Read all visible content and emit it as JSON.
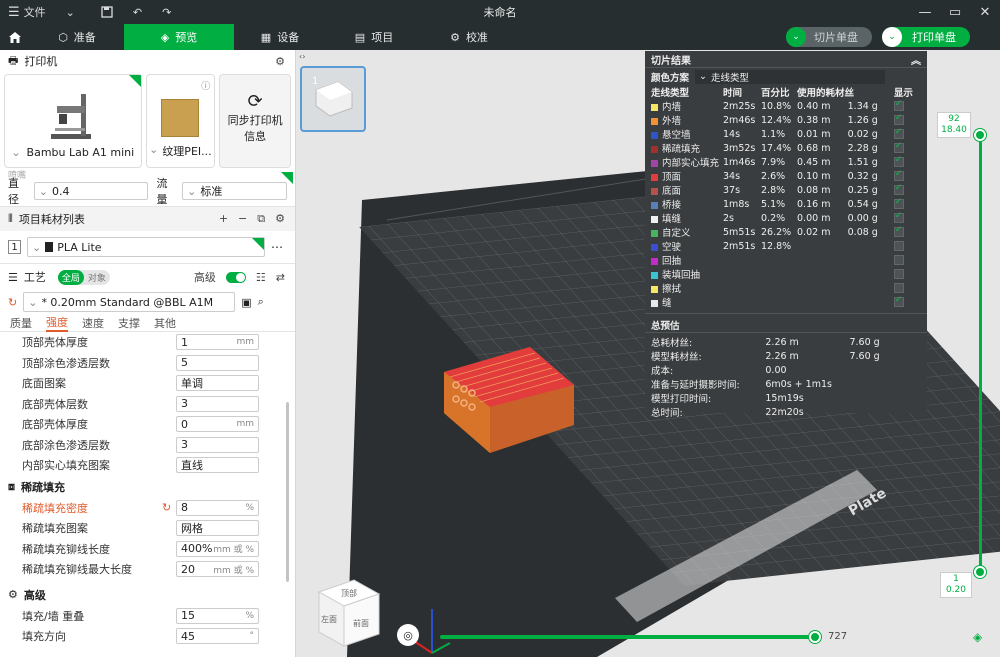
{
  "titlebar": {
    "file_menu": "文件",
    "title": "未命名"
  },
  "tabs": [
    {
      "label": "准备"
    },
    {
      "label": "预览"
    },
    {
      "label": "设备"
    },
    {
      "label": "项目"
    },
    {
      "label": "校准"
    }
  ],
  "actions": {
    "slice_plate": "切片单盘",
    "print_plate": "打印单盘"
  },
  "printer": {
    "section_title": "打印机",
    "model": "Bambu Lab A1 mini",
    "plate": "纹理PEI...",
    "sync_label_1": "同步打印机",
    "sync_label_2": "信息",
    "nozzle_group": "喷嘴",
    "nozzle_label": "直径",
    "nozzle_value": "0.4",
    "flow_label": "流量",
    "flow_value": "标准"
  },
  "filament": {
    "section_title": "项目耗材列表",
    "slot": "1",
    "name": "PLA Lite"
  },
  "process": {
    "section_title": "工艺",
    "global": "全局",
    "object": "对象",
    "advanced": "高级",
    "preset": "* 0.20mm Standard @BBL A1M",
    "subtabs": [
      "质量",
      "强度",
      "速度",
      "支撑",
      "其他"
    ]
  },
  "params_top": [
    {
      "label": "顶部壳体厚度",
      "value": "1",
      "unit": "mm"
    },
    {
      "label": "顶部涂色渗透层数",
      "value": "5",
      "unit": ""
    },
    {
      "label": "底面图案",
      "value": "单调",
      "unit": ""
    },
    {
      "label": "底部壳体层数",
      "value": "3",
      "unit": ""
    },
    {
      "label": "底部壳体厚度",
      "value": "0",
      "unit": "mm"
    },
    {
      "label": "底部涂色渗透层数",
      "value": "3",
      "unit": ""
    },
    {
      "label": "内部实心填充图案",
      "value": "直线",
      "unit": ""
    }
  ],
  "sparse": {
    "title": "稀疏填充",
    "rows": [
      {
        "label": "稀疏填充密度",
        "value": "8",
        "unit": "%"
      },
      {
        "label": "稀疏填充图案",
        "value": "网格",
        "unit": ""
      },
      {
        "label": "稀疏填充铆线长度",
        "value": "400%",
        "unit": "mm 或 %"
      },
      {
        "label": "稀疏填充铆线最大长度",
        "value": "20",
        "unit": "mm 或 %"
      }
    ]
  },
  "advanced": {
    "title": "高级",
    "rows": [
      {
        "label": "填充/墙 重叠",
        "value": "15",
        "unit": "%"
      },
      {
        "label": "填充方向",
        "value": "45",
        "unit": "°"
      }
    ]
  },
  "results": {
    "title": "切片结果",
    "scheme_label": "颜色方案",
    "scheme_value": "走线类型",
    "headers": [
      "走线类型",
      "时间",
      "百分比",
      "使用的耗材丝",
      "",
      "显示"
    ],
    "rows": [
      {
        "name": "内墙",
        "color": "#f5e663",
        "time": "2m25s",
        "pct": "10.8%",
        "len": "0.40 m",
        "wt": "1.34 g",
        "show": true
      },
      {
        "name": "外墙",
        "color": "#f29235",
        "time": "2m46s",
        "pct": "12.4%",
        "len": "0.38 m",
        "wt": "1.26 g",
        "show": true
      },
      {
        "name": "悬空墙",
        "color": "#2d54c9",
        "time": "14s",
        "pct": "1.1%",
        "len": "0.01 m",
        "wt": "0.02 g",
        "show": true
      },
      {
        "name": "稀疏填充",
        "color": "#a0322a",
        "time": "3m52s",
        "pct": "17.4%",
        "len": "0.68 m",
        "wt": "2.28 g",
        "show": true
      },
      {
        "name": "内部实心填充",
        "color": "#a044a8",
        "time": "1m46s",
        "pct": "7.9%",
        "len": "0.45 m",
        "wt": "1.51 g",
        "show": true
      },
      {
        "name": "顶面",
        "color": "#e23c3c",
        "time": "34s",
        "pct": "2.6%",
        "len": "0.10 m",
        "wt": "0.32 g",
        "show": true
      },
      {
        "name": "底面",
        "color": "#b5524a",
        "time": "37s",
        "pct": "2.8%",
        "len": "0.08 m",
        "wt": "0.25 g",
        "show": true
      },
      {
        "name": "桥接",
        "color": "#5a7fb6",
        "time": "1m8s",
        "pct": "5.1%",
        "len": "0.16 m",
        "wt": "0.54 g",
        "show": true
      },
      {
        "name": "填缝",
        "color": "#f0f0f0",
        "time": "2s",
        "pct": "0.2%",
        "len": "0.00 m",
        "wt": "0.00 g",
        "show": true
      },
      {
        "name": "自定义",
        "color": "#48b35a",
        "time": "5m51s",
        "pct": "26.2%",
        "len": "0.02 m",
        "wt": "0.08 g",
        "show": true
      },
      {
        "name": "空驶",
        "color": "#3a4fd0",
        "time": "2m51s",
        "pct": "12.8%",
        "len": "",
        "wt": "",
        "show": false
      },
      {
        "name": "回抽",
        "color": "#c42bc8",
        "time": "",
        "pct": "",
        "len": "",
        "wt": "",
        "show": false
      },
      {
        "name": "装填回抽",
        "color": "#39c3d0",
        "time": "",
        "pct": "",
        "len": "",
        "wt": "",
        "show": false
      },
      {
        "name": "擦拭",
        "color": "#f5e663",
        "time": "",
        "pct": "",
        "len": "",
        "wt": "",
        "show": false
      },
      {
        "name": "缝",
        "color": "#e8e8e8",
        "time": "",
        "pct": "",
        "len": "",
        "wt": "",
        "show": true
      }
    ],
    "summary_title": "总预估",
    "summary": [
      {
        "label": "总耗材丝:",
        "v1": "2.26 m",
        "v2": "7.60 g"
      },
      {
        "label": "模型耗材丝:",
        "v1": "2.26 m",
        "v2": "7.60 g"
      },
      {
        "label": "成本:",
        "v1": "0.00",
        "v2": ""
      },
      {
        "label": "准备与延时摄影时间:",
        "v1": "6m0s + 1m1s",
        "v2": ""
      },
      {
        "label": "模型打印时间:",
        "v1": "15m19s",
        "v2": ""
      },
      {
        "label": "总时间:",
        "v1": "22m20s",
        "v2": ""
      }
    ]
  },
  "layer_slider": {
    "top_layer": "92",
    "top_height": "18.40",
    "bottom_layer": "1",
    "bottom_height": "0.20"
  },
  "move_slider": {
    "value": "727"
  },
  "thumb": {
    "index": "1"
  },
  "viewcube": {
    "top": "顶部",
    "left": "左面",
    "front": "前面"
  },
  "plate_text": "Plate",
  "colors": {
    "accent": "#00ae42",
    "warning": "#e05a2b",
    "model_top": "#e23c3c",
    "model_side": "#d8742a"
  }
}
